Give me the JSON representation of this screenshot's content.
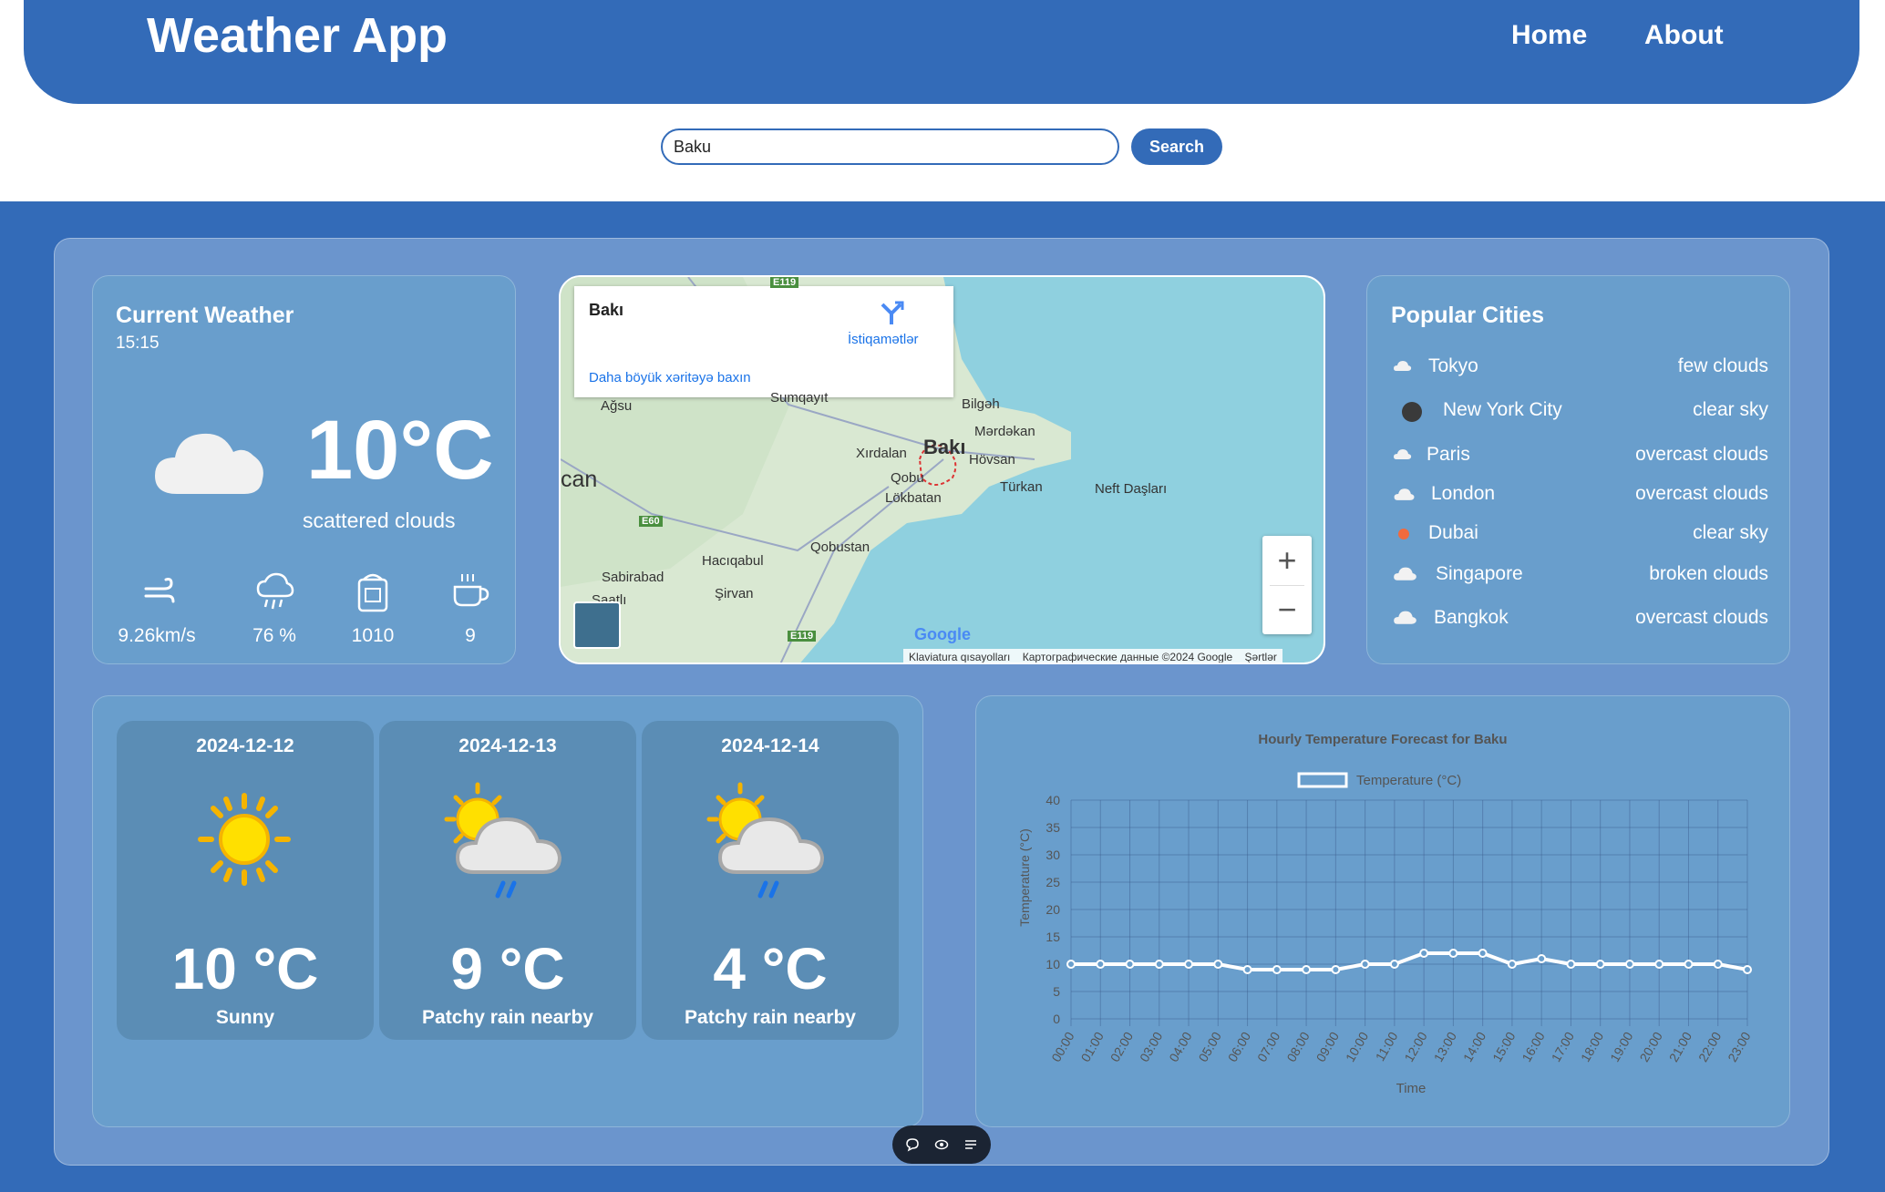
{
  "header": {
    "title": "Weather App",
    "nav": [
      "Home",
      "About"
    ]
  },
  "search": {
    "value": "Baku",
    "button_label": "Search"
  },
  "current_weather": {
    "title": "Current Weather",
    "time": "15:15",
    "temperature": "10°C",
    "description": "scattered clouds",
    "icon": "cloud-icon",
    "stats": [
      {
        "icon": "wind-icon",
        "value": "9.26km/s"
      },
      {
        "icon": "humidity-icon",
        "value": "76 %"
      },
      {
        "icon": "pressure-icon",
        "value": "1010"
      },
      {
        "icon": "cup-icon",
        "value": "9"
      }
    ]
  },
  "map": {
    "place_name": "Bakı",
    "directions_label": "İstiqamətlər",
    "larger_map_link": "Daha böyük xəritəyə baxın",
    "footer": [
      "Klaviatura qısayolları",
      "Картографические данные ©2024 Google",
      "Şərtlər"
    ],
    "labels": {
      "sumqayit": "Sumqayıt",
      "agsu": "Ağsu",
      "bilgeh": "Bilgəh",
      "merdekan": "Mərdəkan",
      "xirdalan": "Xırdalan",
      "baki": "Bakı",
      "hovsan": "Hövsan",
      "qobu": "Qobu",
      "lokbatan": "Lökbatan",
      "turkan": "Türkan",
      "neft": "Neft Daşları",
      "can": "can",
      "qobustan": "Qobustan",
      "haciqabul": "Hacıqabul",
      "sabirabad": "Sabirabad",
      "sirvan": "Şirvan",
      "saatli": "Saatlı",
      "e119a": "E119",
      "e60": "E60",
      "e119b": "E119",
      "google": "Google"
    },
    "zoom_in": "+",
    "zoom_out": "−"
  },
  "popular_cities": {
    "title": "Popular Cities",
    "items": [
      {
        "name": "Tokyo",
        "desc": "few clouds",
        "icon": "few-clouds-icon"
      },
      {
        "name": "New York City",
        "desc": "clear sky",
        "icon": "clear-night-icon"
      },
      {
        "name": "Paris",
        "desc": "overcast clouds",
        "icon": "overcast-icon"
      },
      {
        "name": "London",
        "desc": "overcast clouds",
        "icon": "overcast-icon"
      },
      {
        "name": "Dubai",
        "desc": "clear sky",
        "icon": "clear-day-icon"
      },
      {
        "name": "Singapore",
        "desc": "broken clouds",
        "icon": "broken-clouds-icon"
      },
      {
        "name": "Bangkok",
        "desc": "overcast clouds",
        "icon": "overcast-icon"
      }
    ]
  },
  "forecast": [
    {
      "date": "2024-12-12",
      "temp": "10 °C",
      "condition": "Sunny",
      "icon": "sun-icon"
    },
    {
      "date": "2024-12-13",
      "temp": "9 °C",
      "condition": "Patchy rain nearby",
      "icon": "sun-cloud-rain-icon"
    },
    {
      "date": "2024-12-14",
      "temp": "4 °C",
      "condition": "Patchy rain nearby",
      "icon": "sun-cloud-rain-icon"
    }
  ],
  "chart_data": {
    "type": "line",
    "title": "Hourly Temperature Forecast for Baku",
    "xlabel": "Time",
    "ylabel": "Temperature (°C)",
    "categories": [
      "00:00",
      "01:00",
      "02:00",
      "03:00",
      "04:00",
      "05:00",
      "06:00",
      "07:00",
      "08:00",
      "09:00",
      "10:00",
      "11:00",
      "12:00",
      "13:00",
      "14:00",
      "15:00",
      "16:00",
      "17:00",
      "18:00",
      "19:00",
      "20:00",
      "21:00",
      "22:00",
      "23:00"
    ],
    "series": [
      {
        "name": "Temperature (°C)",
        "values": [
          10,
          10,
          10,
          10,
          10,
          10,
          9,
          9,
          9,
          9,
          10,
          10,
          12,
          12,
          12,
          10,
          11,
          10,
          10,
          10,
          10,
          10,
          10,
          9
        ],
        "color": "#ffffff"
      }
    ],
    "ylim": [
      0,
      40
    ],
    "yticks": [
      "0",
      "5",
      "10",
      "15",
      "20",
      "25",
      "30",
      "35",
      "40"
    ],
    "grid": true,
    "legend": "top"
  },
  "colors": {
    "primary": "#336bb8",
    "panel": "#699ecc",
    "forecast_card": "#5b8db5"
  }
}
